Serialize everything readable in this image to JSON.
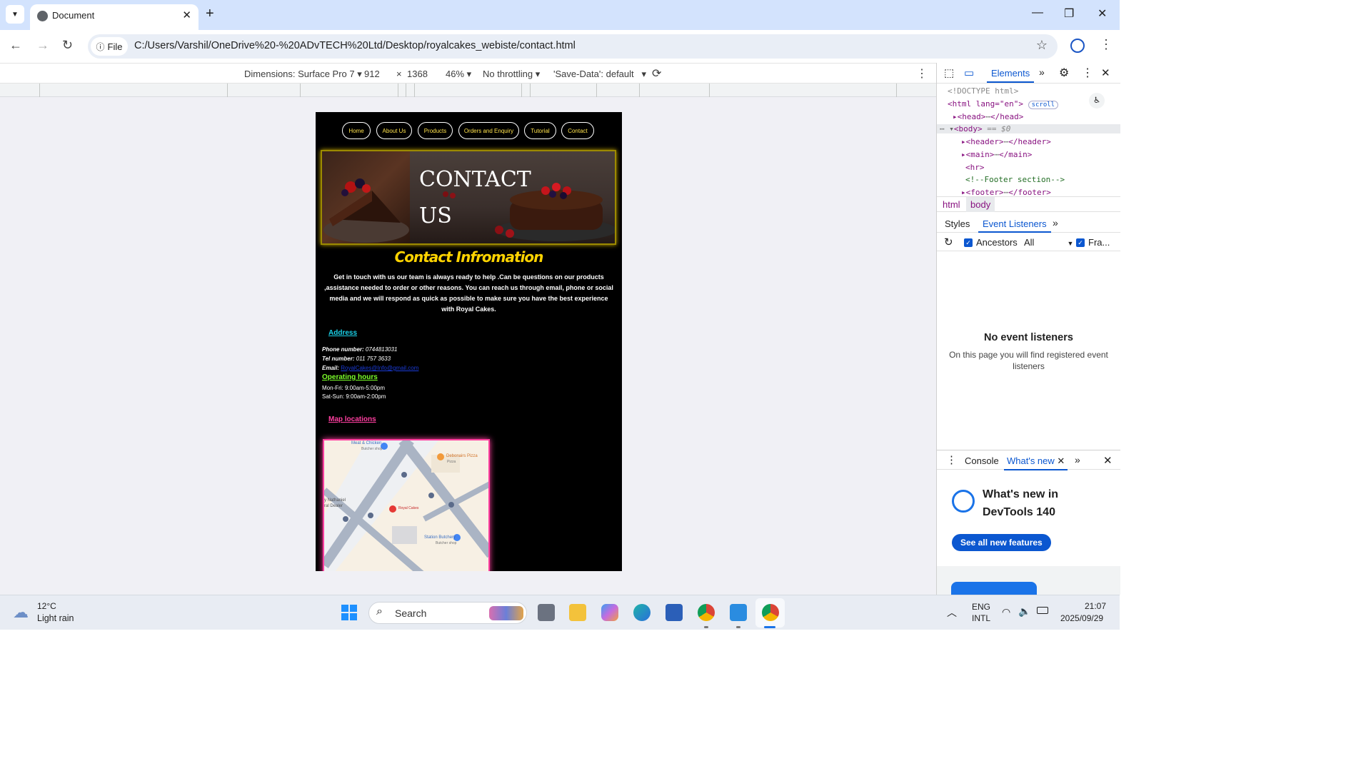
{
  "browser": {
    "tab_title": "Document",
    "url": "C:/Users/Varshil/OneDrive%20-%20ADvTECH%20Ltd/Desktop/royalcakes_webiste/contact.html",
    "file_chip": "File"
  },
  "device_toolbar": {
    "dimensions": "Dimensions: Surface Pro 7",
    "width": "912",
    "times": "×",
    "height": "1368",
    "zoom": "46%",
    "throttling": "No throttling",
    "save_data": "'Save-Data': default"
  },
  "site": {
    "nav": [
      "Home",
      "About Us",
      "Products",
      "Orders and Enquiry",
      "Tutorial",
      "Contact"
    ],
    "hero_title_line1": "CONTACT",
    "hero_title_line2": "US",
    "heading": "Contact Infromation",
    "intro": "Get in touch with us our team is always ready to help .Can be questions on our products ,assistance needed to order or other reasons. You can reach us through email, phone or social media and we will respond as quick as possible to make sure you have the best experience with Royal Cakes.",
    "address_link": "Address",
    "phone_label": "Phone number:",
    "phone_value": "0744813031",
    "tel_label": "Tel number:",
    "tel_value": "011 757 3633",
    "email_label": "Email:",
    "email_value": "RoyalCakes@Info@gmail.com",
    "hours_link": "Operating hours",
    "hours_weekday": "Mon-Fri: 9:00am-5:00pm",
    "hours_weekend": "Sat-Sun: 9:00am-2:00pm",
    "map_link": "Map locations",
    "map_labels": {
      "meat": "Meat & Chicken",
      "meat_sub": "Butcher shop",
      "debonairs": "Debonairs Pizza",
      "debonairs_sub": "Pizza",
      "royal": "Royal Cakes",
      "station": "Station Butchery",
      "station_sub": "Butcher shop",
      "nathaniel": "y Nathaniel",
      "dealer": "ral Dealer"
    }
  },
  "devtools": {
    "tab_elements": "Elements",
    "dom": {
      "doctype": "<!DOCTYPE html>",
      "html_open": "<html lang=\"en\">",
      "scroll_badge": "scroll",
      "head": "<head>",
      "head_close": "</head>",
      "body": "<body>",
      "body_ref": "== $0",
      "header": "<header>",
      "header_close": "</header>",
      "main": "<main>",
      "main_close": "</main>",
      "hr": "<hr>",
      "comment": "<!--Footer section-->",
      "footer": "<footer>",
      "footer_close": "</footer>"
    },
    "crumbs": [
      "html",
      "body"
    ],
    "subtab_styles": "Styles",
    "subtab_listeners": "Event Listeners",
    "ancestors": "Ancestors",
    "filter": "All",
    "frameworks": "Fra...",
    "empty_title": "No event listeners",
    "empty_desc": "On this page you will find registered event listeners",
    "drawer_console": "Console",
    "drawer_whats_new": "What's new",
    "whats_new_title": "What's new in DevTools 140",
    "see_all": "See all new features"
  },
  "taskbar": {
    "temp": "12°C",
    "weather": "Light rain",
    "search": "Search",
    "lang1": "ENG",
    "lang2": "INTL",
    "time": "21:07",
    "date": "2025/09/29"
  }
}
